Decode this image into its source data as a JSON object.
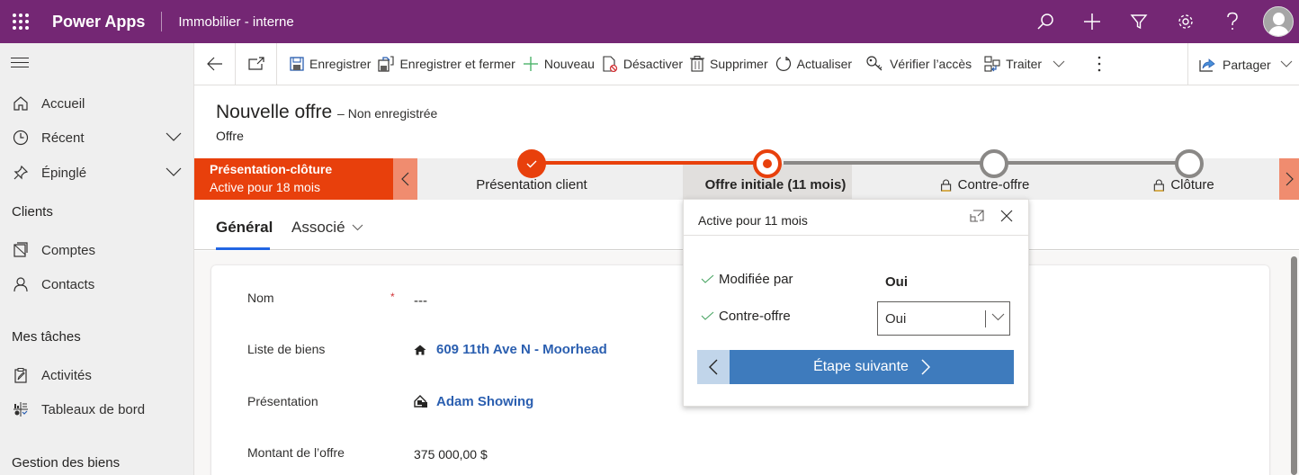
{
  "topbar": {
    "app_name": "Power Apps",
    "environment": "Immobilier - interne",
    "icons": [
      "waffle-icon",
      "search-icon",
      "plus-icon",
      "filter-icon",
      "gear-icon",
      "help-icon",
      "avatar"
    ],
    "background": "#742774"
  },
  "sidebar": {
    "items": [
      {
        "label": "Accueil",
        "icon": "home-icon"
      },
      {
        "label": "Récent",
        "icon": "clock-icon",
        "expandable": true
      },
      {
        "label": "Épinglé",
        "icon": "pin-icon",
        "expandable": true
      }
    ],
    "sections": [
      {
        "title": "Clients",
        "items": [
          {
            "label": "Comptes",
            "icon": "accounts-icon"
          },
          {
            "label": "Contacts",
            "icon": "person-icon"
          }
        ]
      },
      {
        "title": "Mes tâches",
        "items": [
          {
            "label": "Activités",
            "icon": "clipboard-icon"
          },
          {
            "label": "Tableaux de bord",
            "icon": "dashboard-icon"
          }
        ]
      },
      {
        "title": "Gestion des biens",
        "items": []
      }
    ]
  },
  "commandbar": {
    "save": "Enregistrer",
    "save_close": "Enregistrer et fermer",
    "new": "Nouveau",
    "deactivate": "Désactiver",
    "delete": "Supprimer",
    "refresh": "Actualiser",
    "check_access": "Vérifier l’accès",
    "process": "Traiter",
    "share": "Partager"
  },
  "record": {
    "title": "Nouvelle offre",
    "status": "– Non enregistrée",
    "entity": "Offre"
  },
  "bpf": {
    "process_name": "Présentation-clôture",
    "process_duration": "Active pour 18 mois",
    "stages": [
      {
        "label": "Présentation client",
        "state": "completed"
      },
      {
        "label": "Offre initiale (11 mois)",
        "state": "active"
      },
      {
        "label": "Contre-offre",
        "state": "locked"
      },
      {
        "label": "Clôture",
        "state": "locked"
      }
    ],
    "accent": "#e8400c"
  },
  "flyout": {
    "title": "Active pour 11 mois",
    "fields": [
      {
        "label": "Modifiée par",
        "value": "Oui",
        "completed": true
      },
      {
        "label": "Contre-offre",
        "value": "Oui",
        "completed": true,
        "type": "select"
      }
    ],
    "next_label": "Étape suivante",
    "next_color": "#3e7bbd"
  },
  "tabs": [
    {
      "label": "Général",
      "active": true
    },
    {
      "label": "Associé",
      "dropdown": true
    }
  ],
  "form": {
    "fields": [
      {
        "label": "Nom",
        "value": "---",
        "required": true
      },
      {
        "label": "Liste de biens",
        "value": "609 11th Ave N - Moorhead",
        "link": true,
        "icon": "house-icon"
      },
      {
        "label": "Présentation",
        "value": "Adam Showing",
        "link": true,
        "icon": "showing-icon"
      },
      {
        "label": "Montant de l’offre",
        "value": "375 000,00 $"
      }
    ]
  }
}
